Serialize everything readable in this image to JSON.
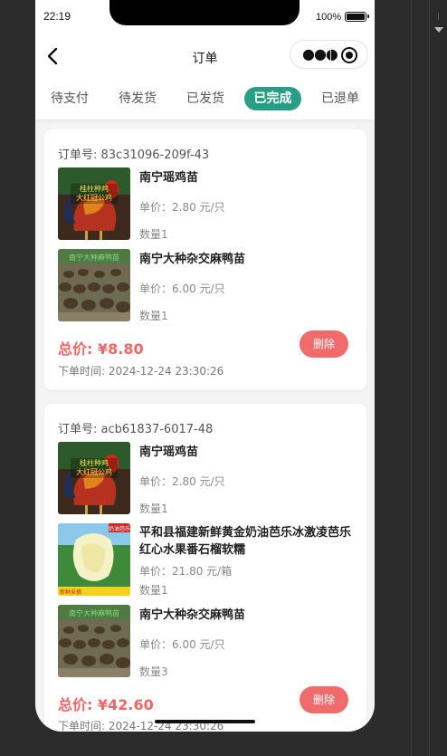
{
  "status_bar": {
    "time": "22:19",
    "battery": "100%"
  },
  "navbar": {
    "title": "订单"
  },
  "tabs": [
    {
      "label": "待支付"
    },
    {
      "label": "待发货"
    },
    {
      "label": "已发货"
    },
    {
      "label": "已完成",
      "active": true
    },
    {
      "label": "已退单"
    }
  ],
  "labels": {
    "order_no_prefix": "订单号: ",
    "price_prefix": "单价：",
    "qty_prefix": "数量",
    "total_prefix": "总价: ",
    "time_prefix": "下单时间: ",
    "delete": "删除"
  },
  "orders": [
    {
      "order_no": "订单号: 83c31096-209f-43",
      "items": [
        {
          "name": "南宁瑶鸡苗",
          "price": "单价：2.80 元/只",
          "qty": "数量1",
          "image": "rooster"
        },
        {
          "name": "南宁大种杂交麻鸭苗",
          "price": "单价：6.00 元/只",
          "qty": "数量1",
          "image": "ducks"
        }
      ],
      "total": "总价: ¥8.80",
      "delete_label": "删除",
      "time": "下单时间: 2024-12-24 23:30:26"
    },
    {
      "order_no": "订单号: acb61837-6017-48",
      "items": [
        {
          "name": "南宁瑶鸡苗",
          "price": "单价：2.80 元/只",
          "qty": "数量1",
          "image": "rooster"
        },
        {
          "name": "平和县福建新鲜黄金奶油芭乐冰激凌芭乐红心水果番石榴软糯",
          "price": "单价：21.80 元/箱",
          "qty": "数量1",
          "image": "guava"
        },
        {
          "name": "南宁大种杂交麻鸭苗",
          "price": "单价：6.00 元/只",
          "qty": "数量3",
          "image": "ducks"
        }
      ],
      "total": "总价: ¥42.60",
      "delete_label": "删除",
      "time": "下单时间: 2024-12-24 23:30:26"
    }
  ],
  "image_texts": {
    "rooster_banner": "桂柱种鸡\n大红冠公鸡",
    "ducks_banner": "南宁大种麻鸭苗",
    "guava_tag": "奶油芭乐",
    "guava_bottom": "新鲜采摘"
  },
  "colors": {
    "accent": "#2a9d86",
    "price_red": "#ee6666",
    "delete_btn": "#f06b6b"
  }
}
